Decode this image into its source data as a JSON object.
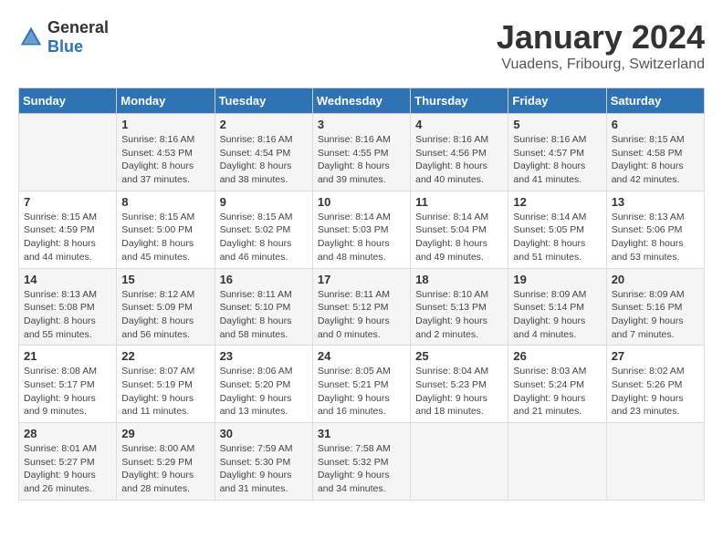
{
  "header": {
    "logo_general": "General",
    "logo_blue": "Blue",
    "month": "January 2024",
    "location": "Vuadens, Fribourg, Switzerland"
  },
  "days_of_week": [
    "Sunday",
    "Monday",
    "Tuesday",
    "Wednesday",
    "Thursday",
    "Friday",
    "Saturday"
  ],
  "weeks": [
    [
      {
        "day": "",
        "sunrise": "",
        "sunset": "",
        "daylight": ""
      },
      {
        "day": "1",
        "sunrise": "Sunrise: 8:16 AM",
        "sunset": "Sunset: 4:53 PM",
        "daylight": "Daylight: 8 hours and 37 minutes."
      },
      {
        "day": "2",
        "sunrise": "Sunrise: 8:16 AM",
        "sunset": "Sunset: 4:54 PM",
        "daylight": "Daylight: 8 hours and 38 minutes."
      },
      {
        "day": "3",
        "sunrise": "Sunrise: 8:16 AM",
        "sunset": "Sunset: 4:55 PM",
        "daylight": "Daylight: 8 hours and 39 minutes."
      },
      {
        "day": "4",
        "sunrise": "Sunrise: 8:16 AM",
        "sunset": "Sunset: 4:56 PM",
        "daylight": "Daylight: 8 hours and 40 minutes."
      },
      {
        "day": "5",
        "sunrise": "Sunrise: 8:16 AM",
        "sunset": "Sunset: 4:57 PM",
        "daylight": "Daylight: 8 hours and 41 minutes."
      },
      {
        "day": "6",
        "sunrise": "Sunrise: 8:15 AM",
        "sunset": "Sunset: 4:58 PM",
        "daylight": "Daylight: 8 hours and 42 minutes."
      }
    ],
    [
      {
        "day": "7",
        "sunrise": "Sunrise: 8:15 AM",
        "sunset": "Sunset: 4:59 PM",
        "daylight": "Daylight: 8 hours and 44 minutes."
      },
      {
        "day": "8",
        "sunrise": "Sunrise: 8:15 AM",
        "sunset": "Sunset: 5:00 PM",
        "daylight": "Daylight: 8 hours and 45 minutes."
      },
      {
        "day": "9",
        "sunrise": "Sunrise: 8:15 AM",
        "sunset": "Sunset: 5:02 PM",
        "daylight": "Daylight: 8 hours and 46 minutes."
      },
      {
        "day": "10",
        "sunrise": "Sunrise: 8:14 AM",
        "sunset": "Sunset: 5:03 PM",
        "daylight": "Daylight: 8 hours and 48 minutes."
      },
      {
        "day": "11",
        "sunrise": "Sunrise: 8:14 AM",
        "sunset": "Sunset: 5:04 PM",
        "daylight": "Daylight: 8 hours and 49 minutes."
      },
      {
        "day": "12",
        "sunrise": "Sunrise: 8:14 AM",
        "sunset": "Sunset: 5:05 PM",
        "daylight": "Daylight: 8 hours and 51 minutes."
      },
      {
        "day": "13",
        "sunrise": "Sunrise: 8:13 AM",
        "sunset": "Sunset: 5:06 PM",
        "daylight": "Daylight: 8 hours and 53 minutes."
      }
    ],
    [
      {
        "day": "14",
        "sunrise": "Sunrise: 8:13 AM",
        "sunset": "Sunset: 5:08 PM",
        "daylight": "Daylight: 8 hours and 55 minutes."
      },
      {
        "day": "15",
        "sunrise": "Sunrise: 8:12 AM",
        "sunset": "Sunset: 5:09 PM",
        "daylight": "Daylight: 8 hours and 56 minutes."
      },
      {
        "day": "16",
        "sunrise": "Sunrise: 8:11 AM",
        "sunset": "Sunset: 5:10 PM",
        "daylight": "Daylight: 8 hours and 58 minutes."
      },
      {
        "day": "17",
        "sunrise": "Sunrise: 8:11 AM",
        "sunset": "Sunset: 5:12 PM",
        "daylight": "Daylight: 9 hours and 0 minutes."
      },
      {
        "day": "18",
        "sunrise": "Sunrise: 8:10 AM",
        "sunset": "Sunset: 5:13 PM",
        "daylight": "Daylight: 9 hours and 2 minutes."
      },
      {
        "day": "19",
        "sunrise": "Sunrise: 8:09 AM",
        "sunset": "Sunset: 5:14 PM",
        "daylight": "Daylight: 9 hours and 4 minutes."
      },
      {
        "day": "20",
        "sunrise": "Sunrise: 8:09 AM",
        "sunset": "Sunset: 5:16 PM",
        "daylight": "Daylight: 9 hours and 7 minutes."
      }
    ],
    [
      {
        "day": "21",
        "sunrise": "Sunrise: 8:08 AM",
        "sunset": "Sunset: 5:17 PM",
        "daylight": "Daylight: 9 hours and 9 minutes."
      },
      {
        "day": "22",
        "sunrise": "Sunrise: 8:07 AM",
        "sunset": "Sunset: 5:19 PM",
        "daylight": "Daylight: 9 hours and 11 minutes."
      },
      {
        "day": "23",
        "sunrise": "Sunrise: 8:06 AM",
        "sunset": "Sunset: 5:20 PM",
        "daylight": "Daylight: 9 hours and 13 minutes."
      },
      {
        "day": "24",
        "sunrise": "Sunrise: 8:05 AM",
        "sunset": "Sunset: 5:21 PM",
        "daylight": "Daylight: 9 hours and 16 minutes."
      },
      {
        "day": "25",
        "sunrise": "Sunrise: 8:04 AM",
        "sunset": "Sunset: 5:23 PM",
        "daylight": "Daylight: 9 hours and 18 minutes."
      },
      {
        "day": "26",
        "sunrise": "Sunrise: 8:03 AM",
        "sunset": "Sunset: 5:24 PM",
        "daylight": "Daylight: 9 hours and 21 minutes."
      },
      {
        "day": "27",
        "sunrise": "Sunrise: 8:02 AM",
        "sunset": "Sunset: 5:26 PM",
        "daylight": "Daylight: 9 hours and 23 minutes."
      }
    ],
    [
      {
        "day": "28",
        "sunrise": "Sunrise: 8:01 AM",
        "sunset": "Sunset: 5:27 PM",
        "daylight": "Daylight: 9 hours and 26 minutes."
      },
      {
        "day": "29",
        "sunrise": "Sunrise: 8:00 AM",
        "sunset": "Sunset: 5:29 PM",
        "daylight": "Daylight: 9 hours and 28 minutes."
      },
      {
        "day": "30",
        "sunrise": "Sunrise: 7:59 AM",
        "sunset": "Sunset: 5:30 PM",
        "daylight": "Daylight: 9 hours and 31 minutes."
      },
      {
        "day": "31",
        "sunrise": "Sunrise: 7:58 AM",
        "sunset": "Sunset: 5:32 PM",
        "daylight": "Daylight: 9 hours and 34 minutes."
      },
      {
        "day": "",
        "sunrise": "",
        "sunset": "",
        "daylight": ""
      },
      {
        "day": "",
        "sunrise": "",
        "sunset": "",
        "daylight": ""
      },
      {
        "day": "",
        "sunrise": "",
        "sunset": "",
        "daylight": ""
      }
    ]
  ]
}
